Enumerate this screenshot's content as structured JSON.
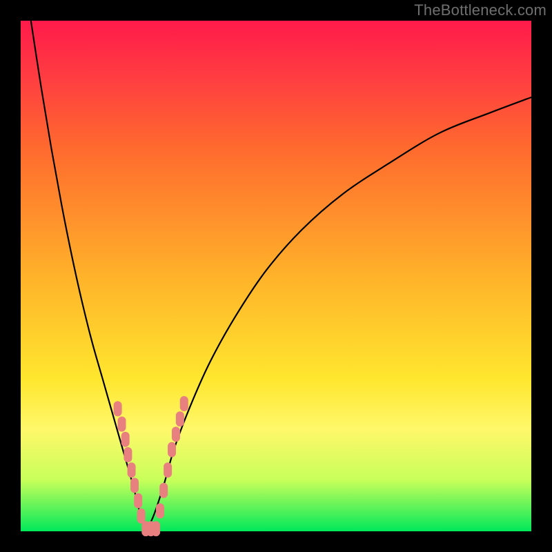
{
  "watermark": "TheBottleneck.com",
  "chart_data": {
    "type": "line",
    "title": "",
    "xlabel": "",
    "ylabel": "",
    "xlim": [
      0,
      100
    ],
    "ylim": [
      0,
      100
    ],
    "grid": false,
    "legend": false,
    "background_gradient": {
      "top": "#ff1a4b",
      "middle": "#ffe62e",
      "bottom": "#00e85a"
    },
    "series": [
      {
        "name": "bottleneck-left-branch",
        "color": "#000000",
        "x": [
          2,
          4,
          6,
          8,
          10,
          12,
          14,
          16,
          18,
          20,
          22,
          23.5,
          24.5
        ],
        "y": [
          100,
          87,
          75,
          64,
          54,
          45,
          37,
          30,
          23,
          16,
          9,
          3,
          0
        ]
      },
      {
        "name": "bottleneck-right-branch",
        "color": "#000000",
        "x": [
          24.5,
          26,
          28,
          30,
          33,
          37,
          42,
          48,
          55,
          63,
          72,
          82,
          92,
          100
        ],
        "y": [
          0,
          3,
          9,
          16,
          24,
          33,
          42,
          51,
          59,
          66,
          72,
          78,
          82,
          85
        ]
      }
    ],
    "markers": [
      {
        "name": "marker-blobs",
        "color": "#e98080",
        "points": [
          {
            "x": 19.0,
            "y": 24
          },
          {
            "x": 19.8,
            "y": 21
          },
          {
            "x": 20.5,
            "y": 18
          },
          {
            "x": 21.0,
            "y": 15
          },
          {
            "x": 21.7,
            "y": 12
          },
          {
            "x": 22.3,
            "y": 9
          },
          {
            "x": 23.0,
            "y": 6
          },
          {
            "x": 23.6,
            "y": 3
          },
          {
            "x": 24.5,
            "y": 0.5
          },
          {
            "x": 25.5,
            "y": 0.5
          },
          {
            "x": 26.5,
            "y": 0.5
          },
          {
            "x": 27.3,
            "y": 4
          },
          {
            "x": 28.0,
            "y": 8
          },
          {
            "x": 28.8,
            "y": 12
          },
          {
            "x": 29.6,
            "y": 16
          },
          {
            "x": 30.4,
            "y": 19
          },
          {
            "x": 31.2,
            "y": 22
          },
          {
            "x": 32.0,
            "y": 25
          }
        ]
      }
    ]
  }
}
